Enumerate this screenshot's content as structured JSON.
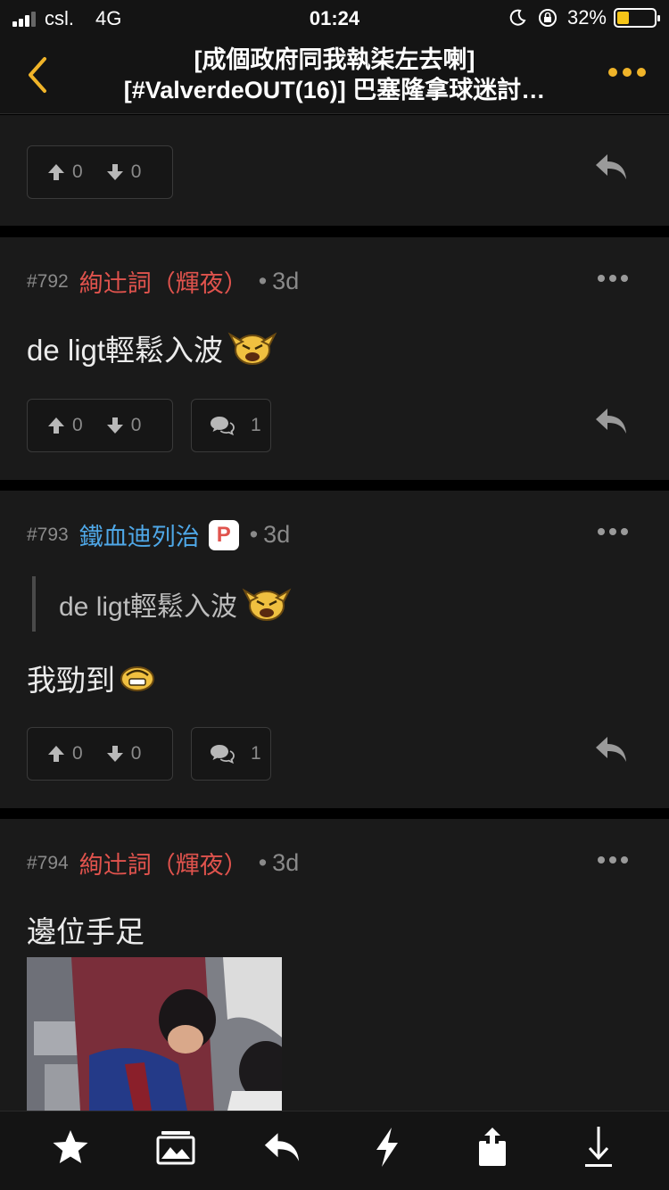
{
  "status": {
    "carrier": "csl.",
    "network": "4G",
    "time": "01:24",
    "battery_percent": "32%",
    "battery_level": 0.32
  },
  "header": {
    "title_line1": "[成個政府同我執柒左去喇]",
    "title_line2": "[#ValverdeOUT(16)] 巴塞隆拿球迷討…"
  },
  "colors": {
    "accent": "#f0b429",
    "author_red": "#e0534d",
    "author_blue": "#4fa8e8"
  },
  "top_post": {
    "upvotes": "0",
    "downvotes": "0"
  },
  "posts": [
    {
      "number": "#792",
      "author": "絢辻詞（輝夜）",
      "age": "3d",
      "text": "de ligt輕鬆入波",
      "upvotes": "0",
      "downvotes": "0",
      "comments": "1"
    },
    {
      "number": "#793",
      "author": "鐵血迪列治",
      "badge": "P",
      "age": "3d",
      "quote": "de ligt輕鬆入波",
      "text": "我勁到",
      "upvotes": "0",
      "downvotes": "0",
      "comments": "1"
    },
    {
      "number": "#794",
      "author": "絢辻詞（輝夜）",
      "age": "3d",
      "text": "邊位手足"
    }
  ],
  "tabbar": [
    "star-icon",
    "image-icon",
    "reply-icon",
    "bolt-icon",
    "share-icon",
    "download-icon"
  ]
}
